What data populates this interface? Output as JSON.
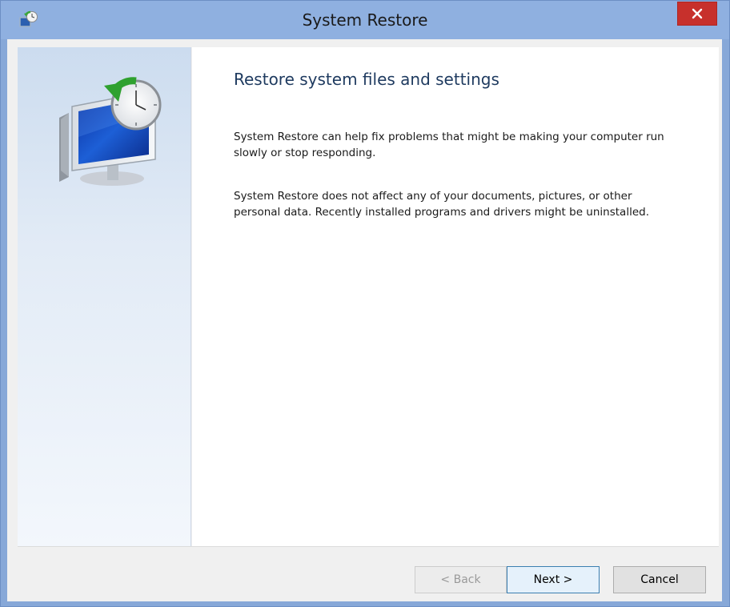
{
  "window": {
    "title": "System Restore",
    "app_icon": "system-restore-icon",
    "close_icon": "close-icon",
    "close_color": "#c7302c"
  },
  "sidebar": {
    "graphic": "monitor-clock-restore-icon"
  },
  "content": {
    "heading": "Restore system files and settings",
    "paragraph1": "System Restore can help fix problems that might be making your computer run slowly or stop responding.",
    "paragraph2": "System Restore does not affect any of your documents, pictures, or other personal data. Recently installed programs and drivers might be uninstalled."
  },
  "buttons": {
    "back_label": "< Back",
    "back_enabled": false,
    "next_label": "Next >",
    "cancel_label": "Cancel"
  }
}
